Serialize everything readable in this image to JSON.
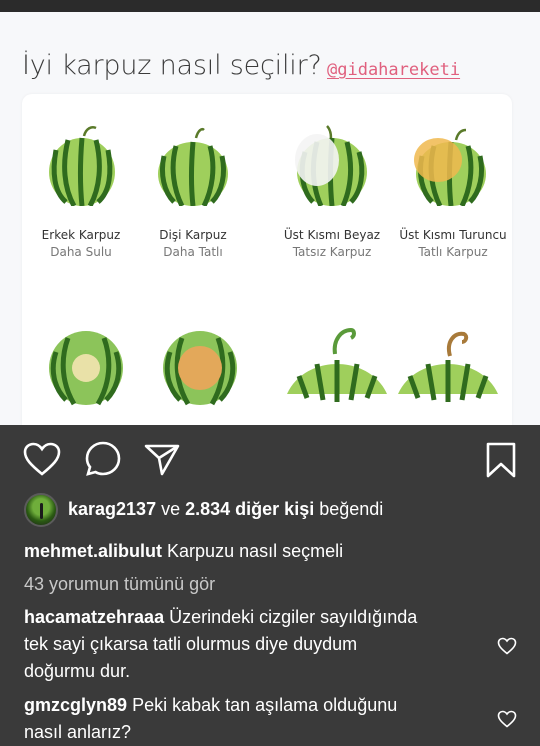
{
  "post": {
    "title": "İyi karpuz nasıl seçilir?",
    "handle": "@gidahareketi",
    "items_top": [
      {
        "title": "Erkek Karpuz",
        "sub": "Daha Sulu"
      },
      {
        "title": "Dişi Karpuz",
        "sub": "Daha Tatlı"
      },
      {
        "title": "Üst Kısmı Beyaz",
        "sub": "Tatsız Karpuz"
      },
      {
        "title": "Üst Kısmı Turuncu",
        "sub": "Tatlı Karpuz"
      }
    ]
  },
  "actions": {
    "like_icon": "heart-icon",
    "comment_icon": "comment-icon",
    "share_icon": "send-icon",
    "save_icon": "bookmark-icon"
  },
  "likes": {
    "user": "karag2137",
    "connector": "ve",
    "others": "2.834 diğer kişi",
    "suffix": "beğendi"
  },
  "caption": {
    "user": "mehmet.alibulut",
    "text": "Karpuzu nasıl seçmeli"
  },
  "view_comments": "43 yorumun tümünü gör",
  "comments": [
    {
      "user": "hacamatzehraaa",
      "line1": "Üzerindeki cizgiler sayıldığında",
      "line2": "tek sayi çıkarsa tatli olurmus diye duydum",
      "line3": "doğurmu dur."
    },
    {
      "user": "gmzcglyn89",
      "line1": "Peki kabak tan aşılama olduğunu",
      "line2": "nasıl anlarız?"
    }
  ],
  "colors": {
    "background": "#3a3a3a",
    "handle": "#e0607e",
    "watermelon_green": "#3f8a2e"
  }
}
